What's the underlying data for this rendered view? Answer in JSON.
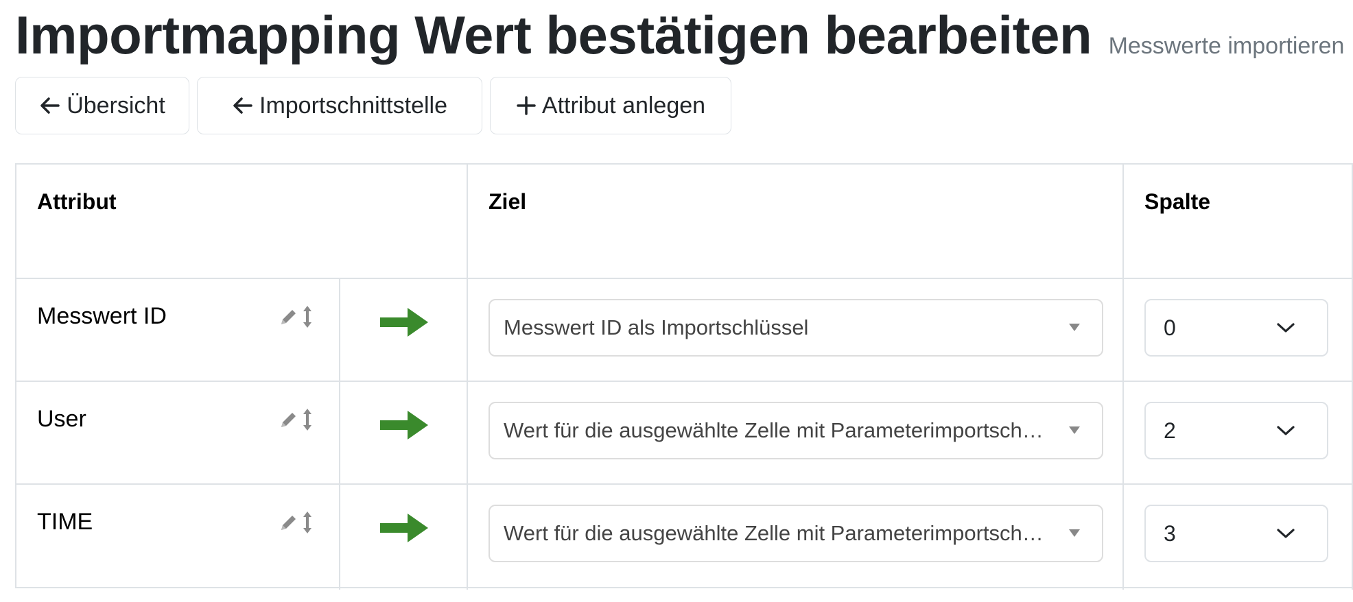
{
  "header": {
    "title": "Importmapping Wert bestätigen bearbeiten",
    "subtitle": "Messwerte importieren"
  },
  "toolbar": {
    "overview_label": "Übersicht",
    "interface_label": "Importschnittstelle",
    "add_attribute_label": "Attribut anlegen"
  },
  "table": {
    "headers": [
      "Attribut",
      "Ziel",
      "Spalte"
    ],
    "rows": [
      {
        "attribute": "Messwert ID",
        "target": "Messwert ID als Importschlüssel",
        "column": "0"
      },
      {
        "attribute": "User",
        "target": "Wert für die ausgewählte Zelle mit Parameterimportschlüssel",
        "column": "2"
      },
      {
        "attribute": "TIME",
        "target": "Wert für die ausgewählte Zelle mit Parameterimportschlüssel",
        "column": "3"
      }
    ]
  },
  "icons": {
    "back": "arrow-left-icon",
    "add": "plus-icon",
    "edit": "pencil-icon",
    "sort": "vertical-arrows-icon",
    "mapping": "right-arrow-icon",
    "dropdown": "chevron-down-icon"
  },
  "colors": {
    "mapping_arrow": "#3a8a2c",
    "border": "#dee2e6",
    "subtitle": "#6c757d"
  }
}
